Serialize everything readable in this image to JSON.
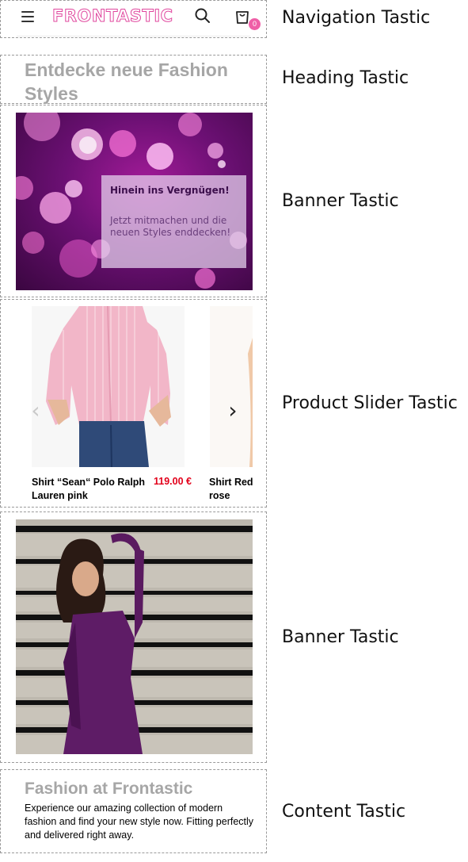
{
  "navigation": {
    "logo": "FRONTASTIC",
    "cart_count": "0",
    "label": "Navigation Tastic",
    "icons": {
      "menu": "hamburger-icon",
      "search": "search-icon",
      "cart": "cart-icon"
    }
  },
  "heading": {
    "text": "Entdecke neue Fashion Styles",
    "label": "Heading Tastic"
  },
  "banner1": {
    "title": "Hinein ins Vergnügen!",
    "text": "Jetzt mitmachen und die neuen Styles enddecken!",
    "label": "Banner Tastic"
  },
  "slider": {
    "label": "Product Slider Tastic",
    "prev_icon": "‹",
    "next_icon": "›",
    "products": [
      {
        "name": "Shirt “Sean“ Polo Ralph Lauren pink",
        "price": "119.00 €"
      },
      {
        "name": "Shirt Red rose",
        "price": ""
      }
    ]
  },
  "banner2": {
    "label": "Banner Tastic"
  },
  "content": {
    "title": "Fashion at Frontastic",
    "text": "Experience our amazing collection of modern fashion and find your new style now. Fitting perfectly and delivered right away.",
    "label": "Content Tastic"
  },
  "colors": {
    "brand_pink": "#e0479e",
    "badge_pink": "#ef5fa7",
    "price_red": "#e2001a",
    "heading_gray": "#a6a6a6"
  }
}
